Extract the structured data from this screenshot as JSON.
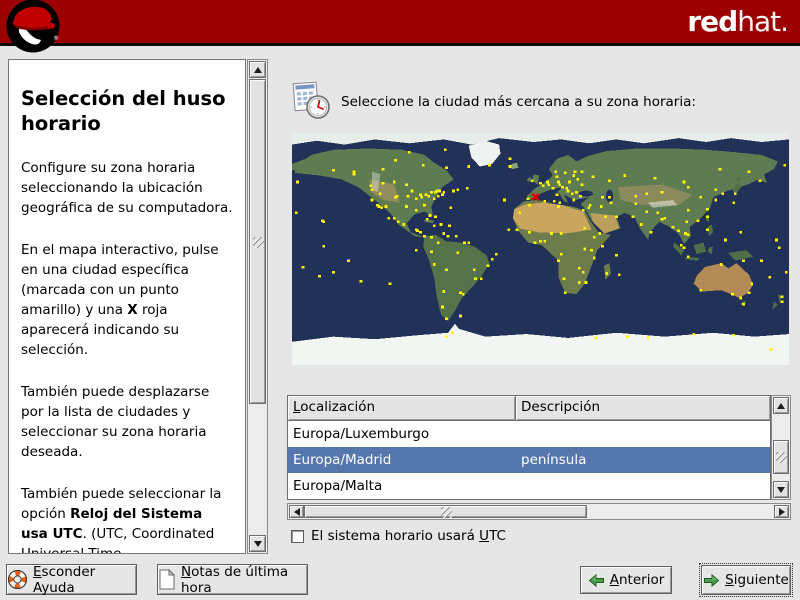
{
  "brand": {
    "wordmark_bold": "red",
    "wordmark_light": "hat.",
    "registered_mark": "®",
    "banner_color": "#9C0101"
  },
  "help": {
    "title": "Selección del huso horario",
    "p1": "Configure su zona horaria seleccionando la ubicación geográfica de su computadora.",
    "p2_pre": "En el mapa interactivo, pulse en una ciudad específica (marcada con un punto amarillo) y una ",
    "p2_bold": "X",
    "p2_post": " roja aparecerá indicando su selección.",
    "p3": "También puede desplazarse por la lista de ciudades y seleccionar su zona horaria deseada.",
    "p4_pre": "También puede seleccionar la opción ",
    "p4_bold": "Reloj del Sistema usa UTC",
    "p4_post": ". (UTC, Coordinated Universal Time, ..."
  },
  "content": {
    "instruction": "Seleccione la ciudad más cercana a su zona horaria:"
  },
  "map": {
    "ocean_color": "#223158",
    "dot_color": "#FFF600",
    "marker_color": "#DD0000",
    "selected_city": {
      "name": "Europa/Madrid",
      "lon": -3.7,
      "lat": 40.4
    },
    "cities": [
      [
        -150,
        61
      ],
      [
        -176,
        52
      ],
      [
        -157,
        21
      ],
      [
        -158,
        22
      ],
      [
        -135,
        58
      ],
      [
        -123,
        49
      ],
      [
        -122,
        46
      ],
      [
        -122,
        38
      ],
      [
        -118,
        34
      ],
      [
        -117,
        33
      ],
      [
        -112,
        33
      ],
      [
        -116,
        43
      ],
      [
        -105,
        40
      ],
      [
        -104,
        41
      ],
      [
        -97,
        33
      ],
      [
        -96,
        41
      ],
      [
        -93,
        45
      ],
      [
        -90,
        30
      ],
      [
        -90,
        39
      ],
      [
        -87,
        42
      ],
      [
        -86,
        40
      ],
      [
        -84,
        34
      ],
      [
        -83,
        42
      ],
      [
        -80,
        26
      ],
      [
        -81,
        41
      ],
      [
        -77,
        39
      ],
      [
        -74,
        41
      ],
      [
        -71,
        42
      ],
      [
        -70,
        44
      ],
      [
        -76,
        44
      ],
      [
        -79,
        44
      ],
      [
        -75,
        45
      ],
      [
        -73,
        45
      ],
      [
        -63,
        45
      ],
      [
        -53,
        47
      ],
      [
        -60,
        46
      ],
      [
        -114,
        51
      ],
      [
        -106,
        52
      ],
      [
        -97,
        50
      ],
      [
        -135,
        60
      ],
      [
        -114,
        62
      ],
      [
        -105,
        69
      ],
      [
        -85,
        65
      ],
      [
        -68,
        63
      ],
      [
        -95,
        75
      ],
      [
        -52,
        64
      ],
      [
        -22,
        70
      ],
      [
        -37,
        65
      ],
      [
        -69,
        77
      ],
      [
        -22,
        64
      ],
      [
        -99,
        19
      ],
      [
        -103,
        21
      ],
      [
        -106,
        24
      ],
      [
        -110,
        24
      ],
      [
        -115,
        32
      ],
      [
        -89,
        14
      ],
      [
        -87,
        13
      ],
      [
        -90,
        15
      ],
      [
        -84,
        10
      ],
      [
        -79,
        9
      ],
      [
        -82,
        23
      ],
      [
        -77,
        18
      ],
      [
        -72,
        19
      ],
      [
        -66,
        18
      ],
      [
        -61,
        10
      ],
      [
        -70,
        12
      ],
      [
        -76,
        25
      ],
      [
        -65,
        32
      ],
      [
        -74,
        5
      ],
      [
        -67,
        10
      ],
      [
        -79,
        -2
      ],
      [
        -90,
        -1
      ],
      [
        -77,
        -12
      ],
      [
        -68,
        -16
      ],
      [
        -58,
        -34
      ],
      [
        -56,
        -35
      ],
      [
        -47,
        -23
      ],
      [
        -43,
        -23
      ],
      [
        -48,
        -16
      ],
      [
        -38,
        -13
      ],
      [
        -35,
        -8
      ],
      [
        -32,
        -4
      ],
      [
        -70,
        -33
      ],
      [
        -71,
        -45
      ],
      [
        -68,
        -54
      ],
      [
        -58,
        -52
      ],
      [
        -60,
        -3
      ],
      [
        -55,
        5
      ],
      [
        -52,
        5
      ],
      [
        -26,
        38
      ],
      [
        -15,
        28
      ],
      [
        -23,
        15
      ],
      [
        -17,
        15
      ],
      [
        -8,
        34
      ],
      [
        -6,
        53
      ],
      [
        0,
        51
      ],
      [
        -9,
        39
      ],
      [
        2,
        49
      ],
      [
        5,
        52
      ],
      [
        6,
        50
      ],
      [
        9,
        47
      ],
      [
        12,
        42
      ],
      [
        14,
        36
      ],
      [
        13,
        52
      ],
      [
        12,
        56
      ],
      [
        11,
        60
      ],
      [
        18,
        59
      ],
      [
        25,
        60
      ],
      [
        21,
        52
      ],
      [
        14,
        50
      ],
      [
        16,
        48
      ],
      [
        19,
        47
      ],
      [
        20,
        45
      ],
      [
        24,
        38
      ],
      [
        26,
        44
      ],
      [
        23,
        43
      ],
      [
        30,
        50
      ],
      [
        27,
        54
      ],
      [
        38,
        56
      ],
      [
        30,
        60
      ],
      [
        24,
        57
      ],
      [
        29,
        41
      ],
      [
        3,
        37
      ],
      [
        10,
        37
      ],
      [
        13,
        33
      ],
      [
        31,
        30
      ],
      [
        -8,
        13
      ],
      [
        -4,
        5
      ],
      [
        0,
        6
      ],
      [
        3,
        6
      ],
      [
        8,
        12
      ],
      [
        15,
        12
      ],
      [
        32,
        16
      ],
      [
        39,
        9
      ],
      [
        45,
        2
      ],
      [
        37,
        -1
      ],
      [
        39,
        -7
      ],
      [
        32,
        0
      ],
      [
        15,
        -4
      ],
      [
        13,
        -9
      ],
      [
        28,
        -15
      ],
      [
        31,
        -18
      ],
      [
        28,
        -26
      ],
      [
        18,
        -34
      ],
      [
        17,
        -23
      ],
      [
        33,
        -26
      ],
      [
        48,
        -19
      ],
      [
        57,
        -20
      ],
      [
        55,
        -5
      ],
      [
        43,
        12
      ],
      [
        35,
        32
      ],
      [
        36,
        34
      ],
      [
        44,
        33
      ],
      [
        47,
        25
      ],
      [
        55,
        25
      ],
      [
        51,
        36
      ],
      [
        45,
        40
      ],
      [
        50,
        40
      ],
      [
        69,
        35
      ],
      [
        67,
        25
      ],
      [
        69,
        41
      ],
      [
        77,
        43
      ],
      [
        77,
        29
      ],
      [
        73,
        19
      ],
      [
        80,
        13
      ],
      [
        88,
        23
      ],
      [
        90,
        24
      ],
      [
        85,
        28
      ],
      [
        96,
        17
      ],
      [
        100,
        14
      ],
      [
        105,
        12
      ],
      [
        107,
        11
      ],
      [
        106,
        21
      ],
      [
        107,
        -6
      ],
      [
        104,
        1
      ],
      [
        102,
        3
      ],
      [
        121,
        15
      ],
      [
        114,
        22
      ],
      [
        121,
        25
      ],
      [
        121,
        31
      ],
      [
        116,
        40
      ],
      [
        127,
        46
      ],
      [
        107,
        30
      ],
      [
        88,
        44
      ],
      [
        107,
        48
      ],
      [
        127,
        38
      ],
      [
        140,
        36
      ],
      [
        141,
        43
      ],
      [
        132,
        43
      ],
      [
        130,
        62
      ],
      [
        104,
        52
      ],
      [
        83,
        55
      ],
      [
        61,
        57
      ],
      [
        50,
        53
      ],
      [
        151,
        60
      ],
      [
        159,
        53
      ],
      [
        177,
        65
      ],
      [
        116,
        -32
      ],
      [
        131,
        -12
      ],
      [
        139,
        -35
      ],
      [
        145,
        -38
      ],
      [
        151,
        -34
      ],
      [
        153,
        -27
      ],
      [
        147,
        -43
      ],
      [
        175,
        -37
      ],
      [
        175,
        -41
      ],
      [
        178,
        -18
      ],
      [
        166,
        -22
      ],
      [
        147,
        -9
      ],
      [
        145,
        13
      ],
      [
        160,
        -9
      ],
      [
        173,
        1
      ],
      [
        171,
        7
      ],
      [
        134,
        7
      ],
      [
        -177,
        28
      ],
      [
        -150,
        -18
      ],
      [
        -139,
        -9
      ],
      [
        -109,
        -27
      ],
      [
        -130,
        -25
      ],
      [
        -172,
        -14
      ],
      [
        -160,
        -21
      ],
      [
        -157,
        2
      ],
      [
        167,
        -78
      ],
      [
        -64,
        -65
      ],
      [
        63,
        -68
      ],
      [
        78,
        -69
      ],
      [
        111,
        -66
      ],
      [
        40,
        -69
      ],
      [
        -68,
        -68
      ],
      [
        140,
        -67
      ]
    ]
  },
  "timezone_table": {
    "col_location_mnemonic": "L",
    "col_location_rest": "ocalización",
    "col_description": "Descripción",
    "selected_color": "#5677AE",
    "rows": [
      {
        "location": "Europa/Luxemburgo",
        "description": "",
        "selected": false
      },
      {
        "location": "Europa/Madrid",
        "description": "península",
        "selected": true
      },
      {
        "location": "Europa/Malta",
        "description": "",
        "selected": false
      }
    ]
  },
  "utc_option": {
    "checked": false,
    "label_pre": "El sistema horario usará ",
    "label_mnemonic": "U",
    "label_post": "TC"
  },
  "buttons": {
    "hide_help": {
      "mnemonic": "E",
      "rest": "sconder Ayuda"
    },
    "release_notes": {
      "mnemonic": "N",
      "rest": "otas de última hora"
    },
    "back": {
      "mnemonic": "A",
      "rest": "nterior"
    },
    "next": {
      "mnemonic": "S",
      "rest": "iguiente"
    }
  }
}
